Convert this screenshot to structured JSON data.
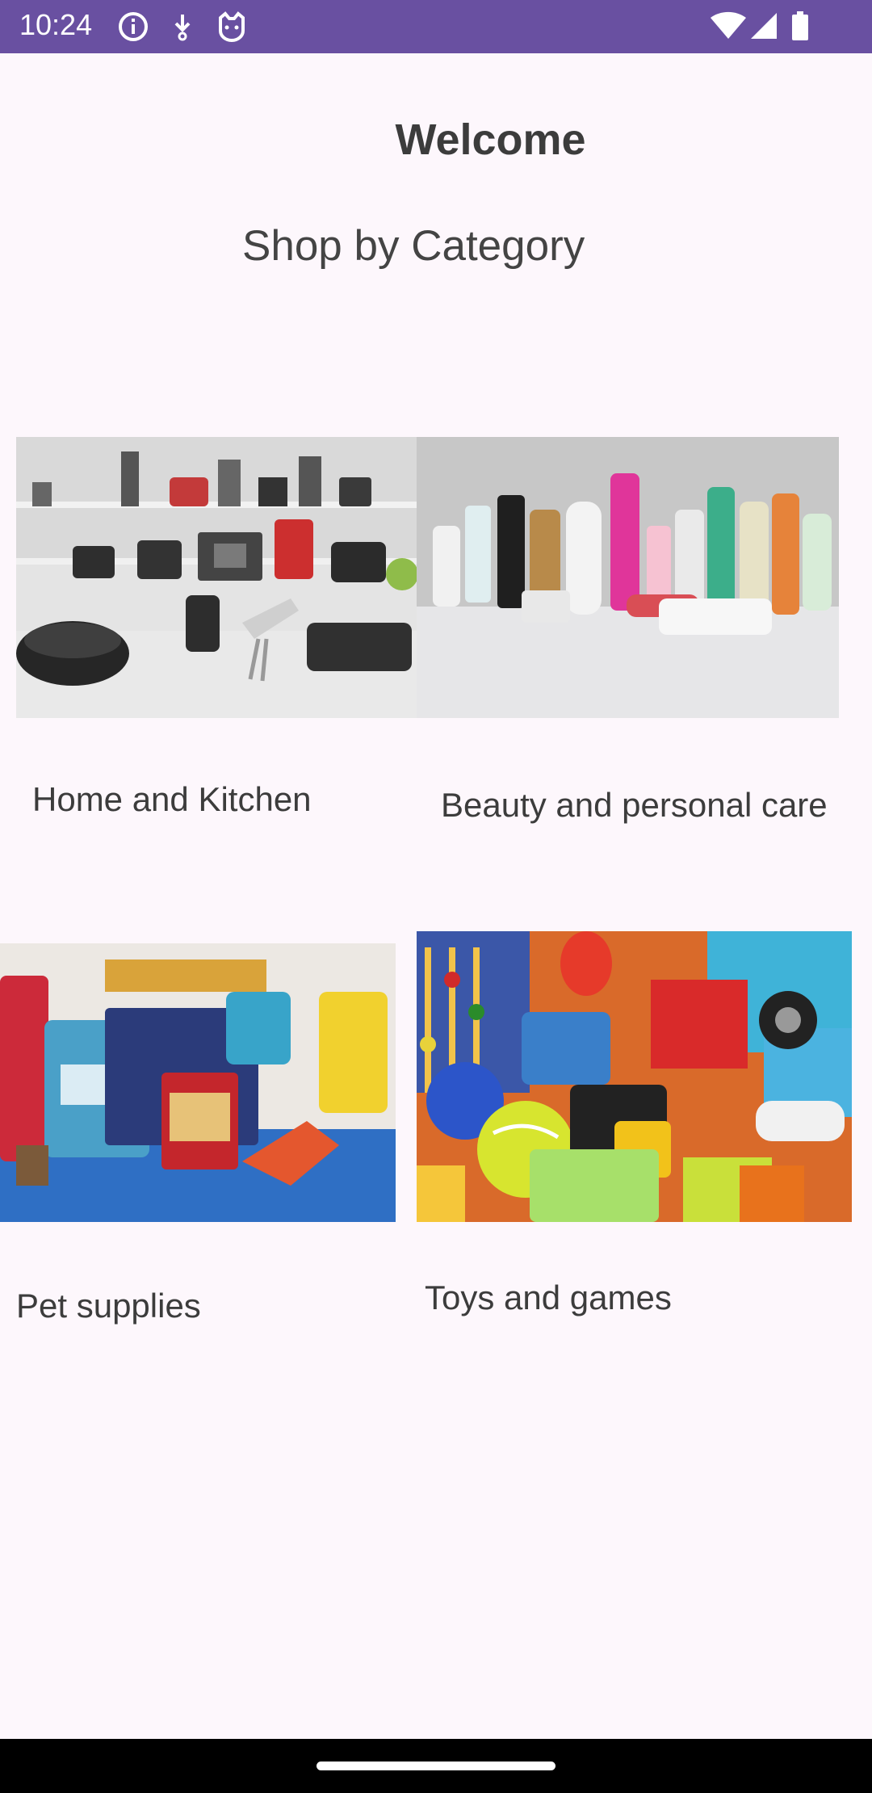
{
  "status_bar": {
    "time": "10:24",
    "icons": [
      "info-icon",
      "download-icon",
      "cat-icon",
      "wifi-icon",
      "signal-icon",
      "battery-icon"
    ],
    "background": "#6950A1"
  },
  "main": {
    "welcome": "Welcome",
    "section_title": "Shop by Category",
    "categories": [
      {
        "label": "Home and Kitchen",
        "image": "kitchen-appliances-image"
      },
      {
        "label": "Beauty and personal care",
        "image": "beauty-products-image"
      },
      {
        "label": "Pet supplies",
        "image": "pet-supplies-image"
      },
      {
        "label": "Toys and games",
        "image": "toys-image"
      }
    ]
  },
  "colors": {
    "background": "#FDF7FC",
    "text": "#3C3C3C"
  }
}
